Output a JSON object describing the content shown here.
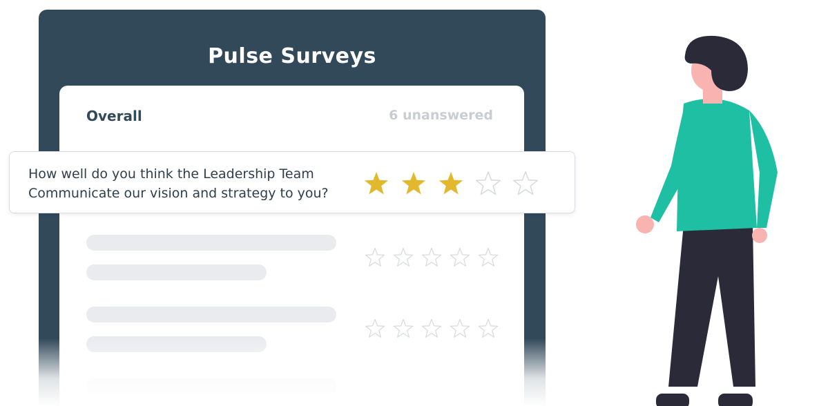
{
  "panel": {
    "title": "Pulse Surveys"
  },
  "section": {
    "title": "Overall",
    "status": "6 unanswered"
  },
  "highlighted_question": {
    "text": "How well do you think the Leadership Team Communicate our vision and strategy to you?",
    "rating": 3,
    "max_rating": 5
  },
  "placeholder_questions": [
    {
      "rating": 0,
      "max_rating": 5
    },
    {
      "rating": 0,
      "max_rating": 5
    }
  ],
  "colors": {
    "panel": "#32495a",
    "star_filled": "#e2b92e",
    "star_empty_outline": "#d7dadd",
    "person_shirt": "#1fbfa3",
    "person_pants": "#2b2a38",
    "person_hair": "#2b2a38",
    "person_skin": "#f9b3b0"
  },
  "icons": {
    "star": "star-icon",
    "illustration": "person-illustration"
  }
}
